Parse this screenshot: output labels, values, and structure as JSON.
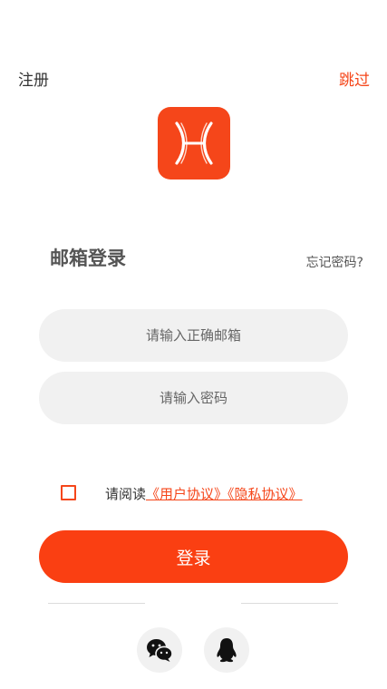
{
  "header": {
    "register_label": "注册",
    "skip_label": "跳过"
  },
  "login": {
    "title": "邮箱登录",
    "forgot_label": "忘记密码?",
    "email_placeholder": "请输入正确邮箱",
    "password_placeholder": "请输入密码",
    "agreement_prefix": "请阅读",
    "user_agreement_label": "《用户协议》",
    "privacy_policy_label": "《隐私协议》",
    "agreement_checked": false,
    "submit_label": "登录"
  },
  "social": {
    "icons": [
      "wechat-icon",
      "qq-icon"
    ]
  },
  "colors": {
    "accent": "#f5461a",
    "button": "#fa3f12",
    "field_bg": "#f1f1f1"
  }
}
